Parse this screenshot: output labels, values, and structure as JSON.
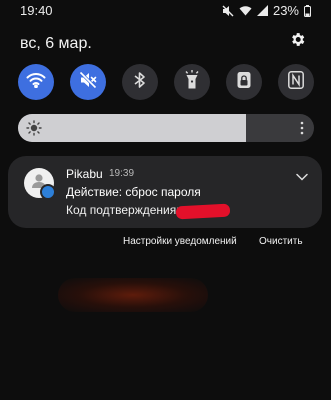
{
  "status_bar": {
    "time": "19:40",
    "battery": "23%",
    "icons": [
      "mute-icon",
      "wifi-icon",
      "signal-icon",
      "battery-icon"
    ]
  },
  "header": {
    "date": "вс, 6 мар.",
    "settings_icon": "gear-icon"
  },
  "quick_settings": [
    {
      "name": "wifi",
      "icon": "wifi-icon",
      "state": "on"
    },
    {
      "name": "sound",
      "icon": "mute-icon",
      "state": "on"
    },
    {
      "name": "bluetooth",
      "icon": "bluetooth-icon",
      "state": "off"
    },
    {
      "name": "flashlight",
      "icon": "flashlight-icon",
      "state": "off"
    },
    {
      "name": "lock",
      "icon": "lock-icon",
      "state": "off"
    },
    {
      "name": "nfc",
      "icon": "nfc-icon",
      "state": "off"
    }
  ],
  "brightness": {
    "level": 0.77
  },
  "notification": {
    "app": "Pikabu",
    "time": "19:39",
    "title": "Действие: сброс пароля",
    "body": "Код подтверждения:"
  },
  "actions": {
    "settings": "Настройки уведомлений",
    "clear": "Очистить"
  },
  "colors": {
    "accent": "#3e6fe0",
    "background": "#0d0d0d",
    "card": "#262628",
    "redaction": "#e3102a"
  }
}
